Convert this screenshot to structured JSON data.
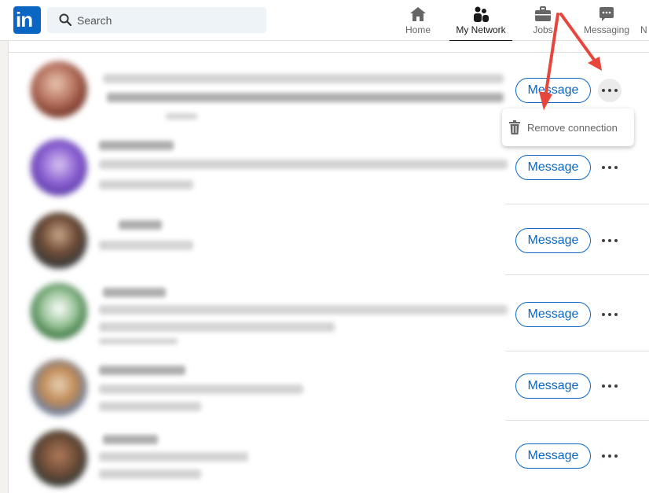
{
  "brand": {
    "logo_text": "in",
    "accent": "#0a66c2"
  },
  "search": {
    "placeholder": "Search",
    "icon": "search-icon"
  },
  "nav": {
    "items": [
      {
        "label": "Home",
        "icon": "home-icon",
        "active": false
      },
      {
        "label": "My Network",
        "icon": "network-icon",
        "active": true
      },
      {
        "label": "Jobs",
        "icon": "briefcase-icon",
        "active": false
      },
      {
        "label": "Messaging",
        "icon": "messaging-icon",
        "active": false
      },
      {
        "label": "N",
        "icon": "bell-icon",
        "active": false
      }
    ]
  },
  "connections": {
    "rows": [
      {
        "message_label": "Message",
        "more_icon": "more-icon"
      },
      {
        "message_label": "Message",
        "more_icon": "more-icon"
      },
      {
        "message_label": "Message",
        "more_icon": "more-icon"
      },
      {
        "message_label": "Message",
        "more_icon": "more-icon"
      },
      {
        "message_label": "Message",
        "more_icon": "more-icon"
      },
      {
        "message_label": "Message",
        "more_icon": "more-icon"
      }
    ]
  },
  "dropdown": {
    "label": "Remove connection",
    "icon": "trash-icon"
  },
  "annotation": {
    "arrow_color": "#e8453c"
  }
}
